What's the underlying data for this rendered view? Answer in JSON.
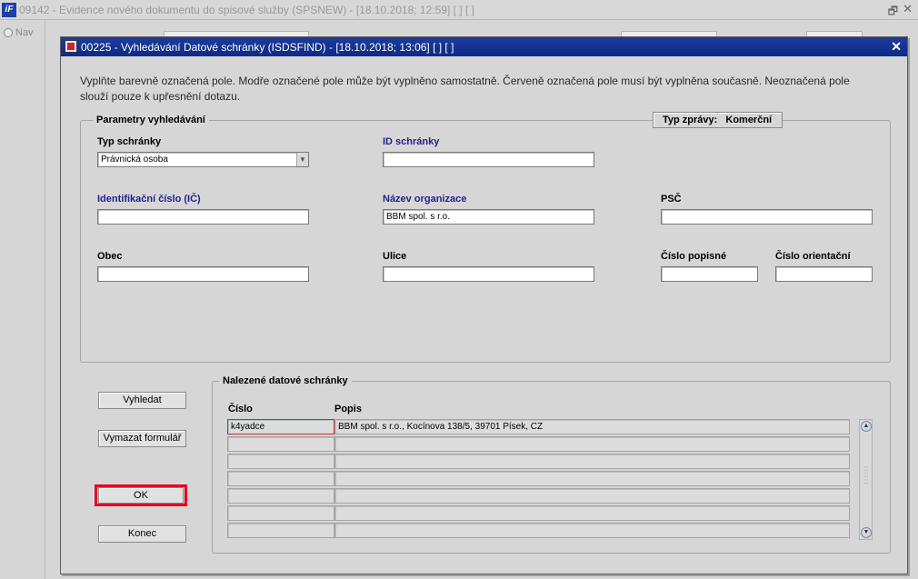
{
  "outer_window": {
    "title": "09142 - Evidence nového dokumentu do spisové služby (SPSNEW) - [18.10.2018; 12:59]  [ ]  [ ]",
    "nav_label": "Nav"
  },
  "dialog": {
    "title": "00225 - Vyhledávání Datové schránky (ISDSFIND) - [18.10.2018; 13:06]  [ ]  [ ]",
    "close_symbol": "✕",
    "instructions": "Vyplňte barevně označená pole. Modře označené pole může být vyplněno samostatně. Červeně označená pole musí být vyplněna současně. Neoznačená pole slouží pouze k upřesnění dotazu."
  },
  "search_params": {
    "legend": "Parametry vyhledávání",
    "message_type_label": "Typ zprávy:",
    "message_type_value": "Komerční",
    "fields": {
      "typ_schranky": {
        "label": "Typ schránky",
        "value": "Právnická osoba"
      },
      "id_schranky": {
        "label": "ID schránky",
        "value": ""
      },
      "ico": {
        "label": "Identifikační číslo (IČ)",
        "value": ""
      },
      "nazev": {
        "label": "Název organizace",
        "value": "BBM spol. s r.o."
      },
      "psc": {
        "label": "PSČ",
        "value": ""
      },
      "obec": {
        "label": "Obec",
        "value": ""
      },
      "ulice": {
        "label": "Ulice",
        "value": ""
      },
      "cislo_popisne": {
        "label": "Číslo popisné",
        "value": ""
      },
      "cislo_orientacni": {
        "label": "Číslo orientační",
        "value": ""
      }
    }
  },
  "buttons": {
    "search": "Vyhledat",
    "clear": "Vymazat formulář",
    "ok": "OK",
    "exit": "Konec"
  },
  "results": {
    "legend": "Nalezené datové schránky",
    "columns": [
      "Číslo",
      "Popis"
    ],
    "rows": [
      {
        "cislo": "k4yadce",
        "popis": "BBM spol. s r.o., Kocínova 138/5, 39701 Písek, CZ"
      },
      {
        "cislo": "",
        "popis": ""
      },
      {
        "cislo": "",
        "popis": ""
      },
      {
        "cislo": "",
        "popis": ""
      },
      {
        "cislo": "",
        "popis": ""
      },
      {
        "cislo": "",
        "popis": ""
      },
      {
        "cislo": "",
        "popis": ""
      }
    ]
  },
  "colors": {
    "title_bar": "#0b2b86",
    "blue_label": "#23238f",
    "highlight_red": "#e3001b"
  },
  "icons": [
    "app-icon",
    "restore-icon",
    "close-icon",
    "dialog-icon",
    "dropdown-arrow-icon",
    "scroll-up-icon",
    "scroll-down-icon",
    "scroll-grip-icon"
  ]
}
